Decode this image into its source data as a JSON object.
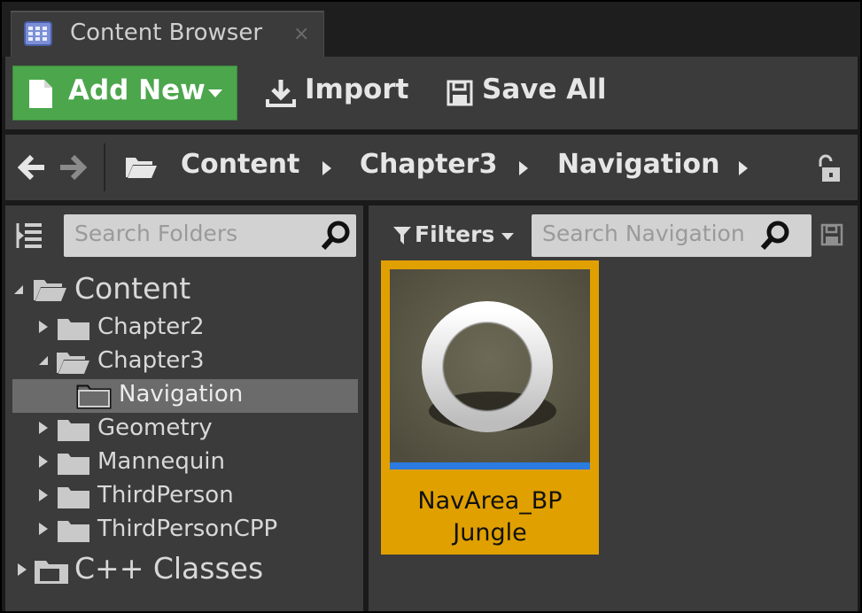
{
  "tab": {
    "title": "Content Browser",
    "close": "×"
  },
  "toolbar": {
    "add_new_label": "Add New",
    "import_label": "Import",
    "save_all_label": "Save All"
  },
  "path": {
    "crumbs": [
      "Content",
      "Chapter3",
      "Navigation"
    ]
  },
  "folders": {
    "search_placeholder": "Search Folders",
    "tree": [
      {
        "label": "Content",
        "level": 0,
        "expanded": true
      },
      {
        "label": "Chapter2",
        "level": 1,
        "expanded": false
      },
      {
        "label": "Chapter3",
        "level": 1,
        "expanded": true
      },
      {
        "label": "Navigation",
        "level": 2,
        "selected": true
      },
      {
        "label": "Geometry",
        "level": 1,
        "expanded": false
      },
      {
        "label": "Mannequin",
        "level": 1,
        "expanded": false
      },
      {
        "label": "ThirdPerson",
        "level": 1,
        "expanded": false
      },
      {
        "label": "ThirdPersonCPP",
        "level": 1,
        "expanded": false
      },
      {
        "label": "C++ Classes",
        "level": 0,
        "expanded": false
      }
    ]
  },
  "assets": {
    "filters_label": "Filters",
    "search_placeholder": "Search Navigation",
    "items": [
      {
        "name_line1": "NavArea_BP",
        "name_line2": "Jungle"
      }
    ]
  },
  "colors": {
    "add_button": "#4ca64c",
    "selected_asset": "#e0a000",
    "asset_type_bar": "#2b7be0",
    "panel_bg": "#3b3b3b"
  },
  "icons": [
    "content-browser-icon",
    "new-file-icon",
    "import-icon",
    "save-icon",
    "back-arrow-icon",
    "forward-arrow-icon",
    "open-folder-icon",
    "unlock-icon",
    "tree-toggle-icon",
    "search-icon",
    "folder-icon",
    "cpp-folder-icon",
    "filter-icon",
    "save-search-icon"
  ]
}
